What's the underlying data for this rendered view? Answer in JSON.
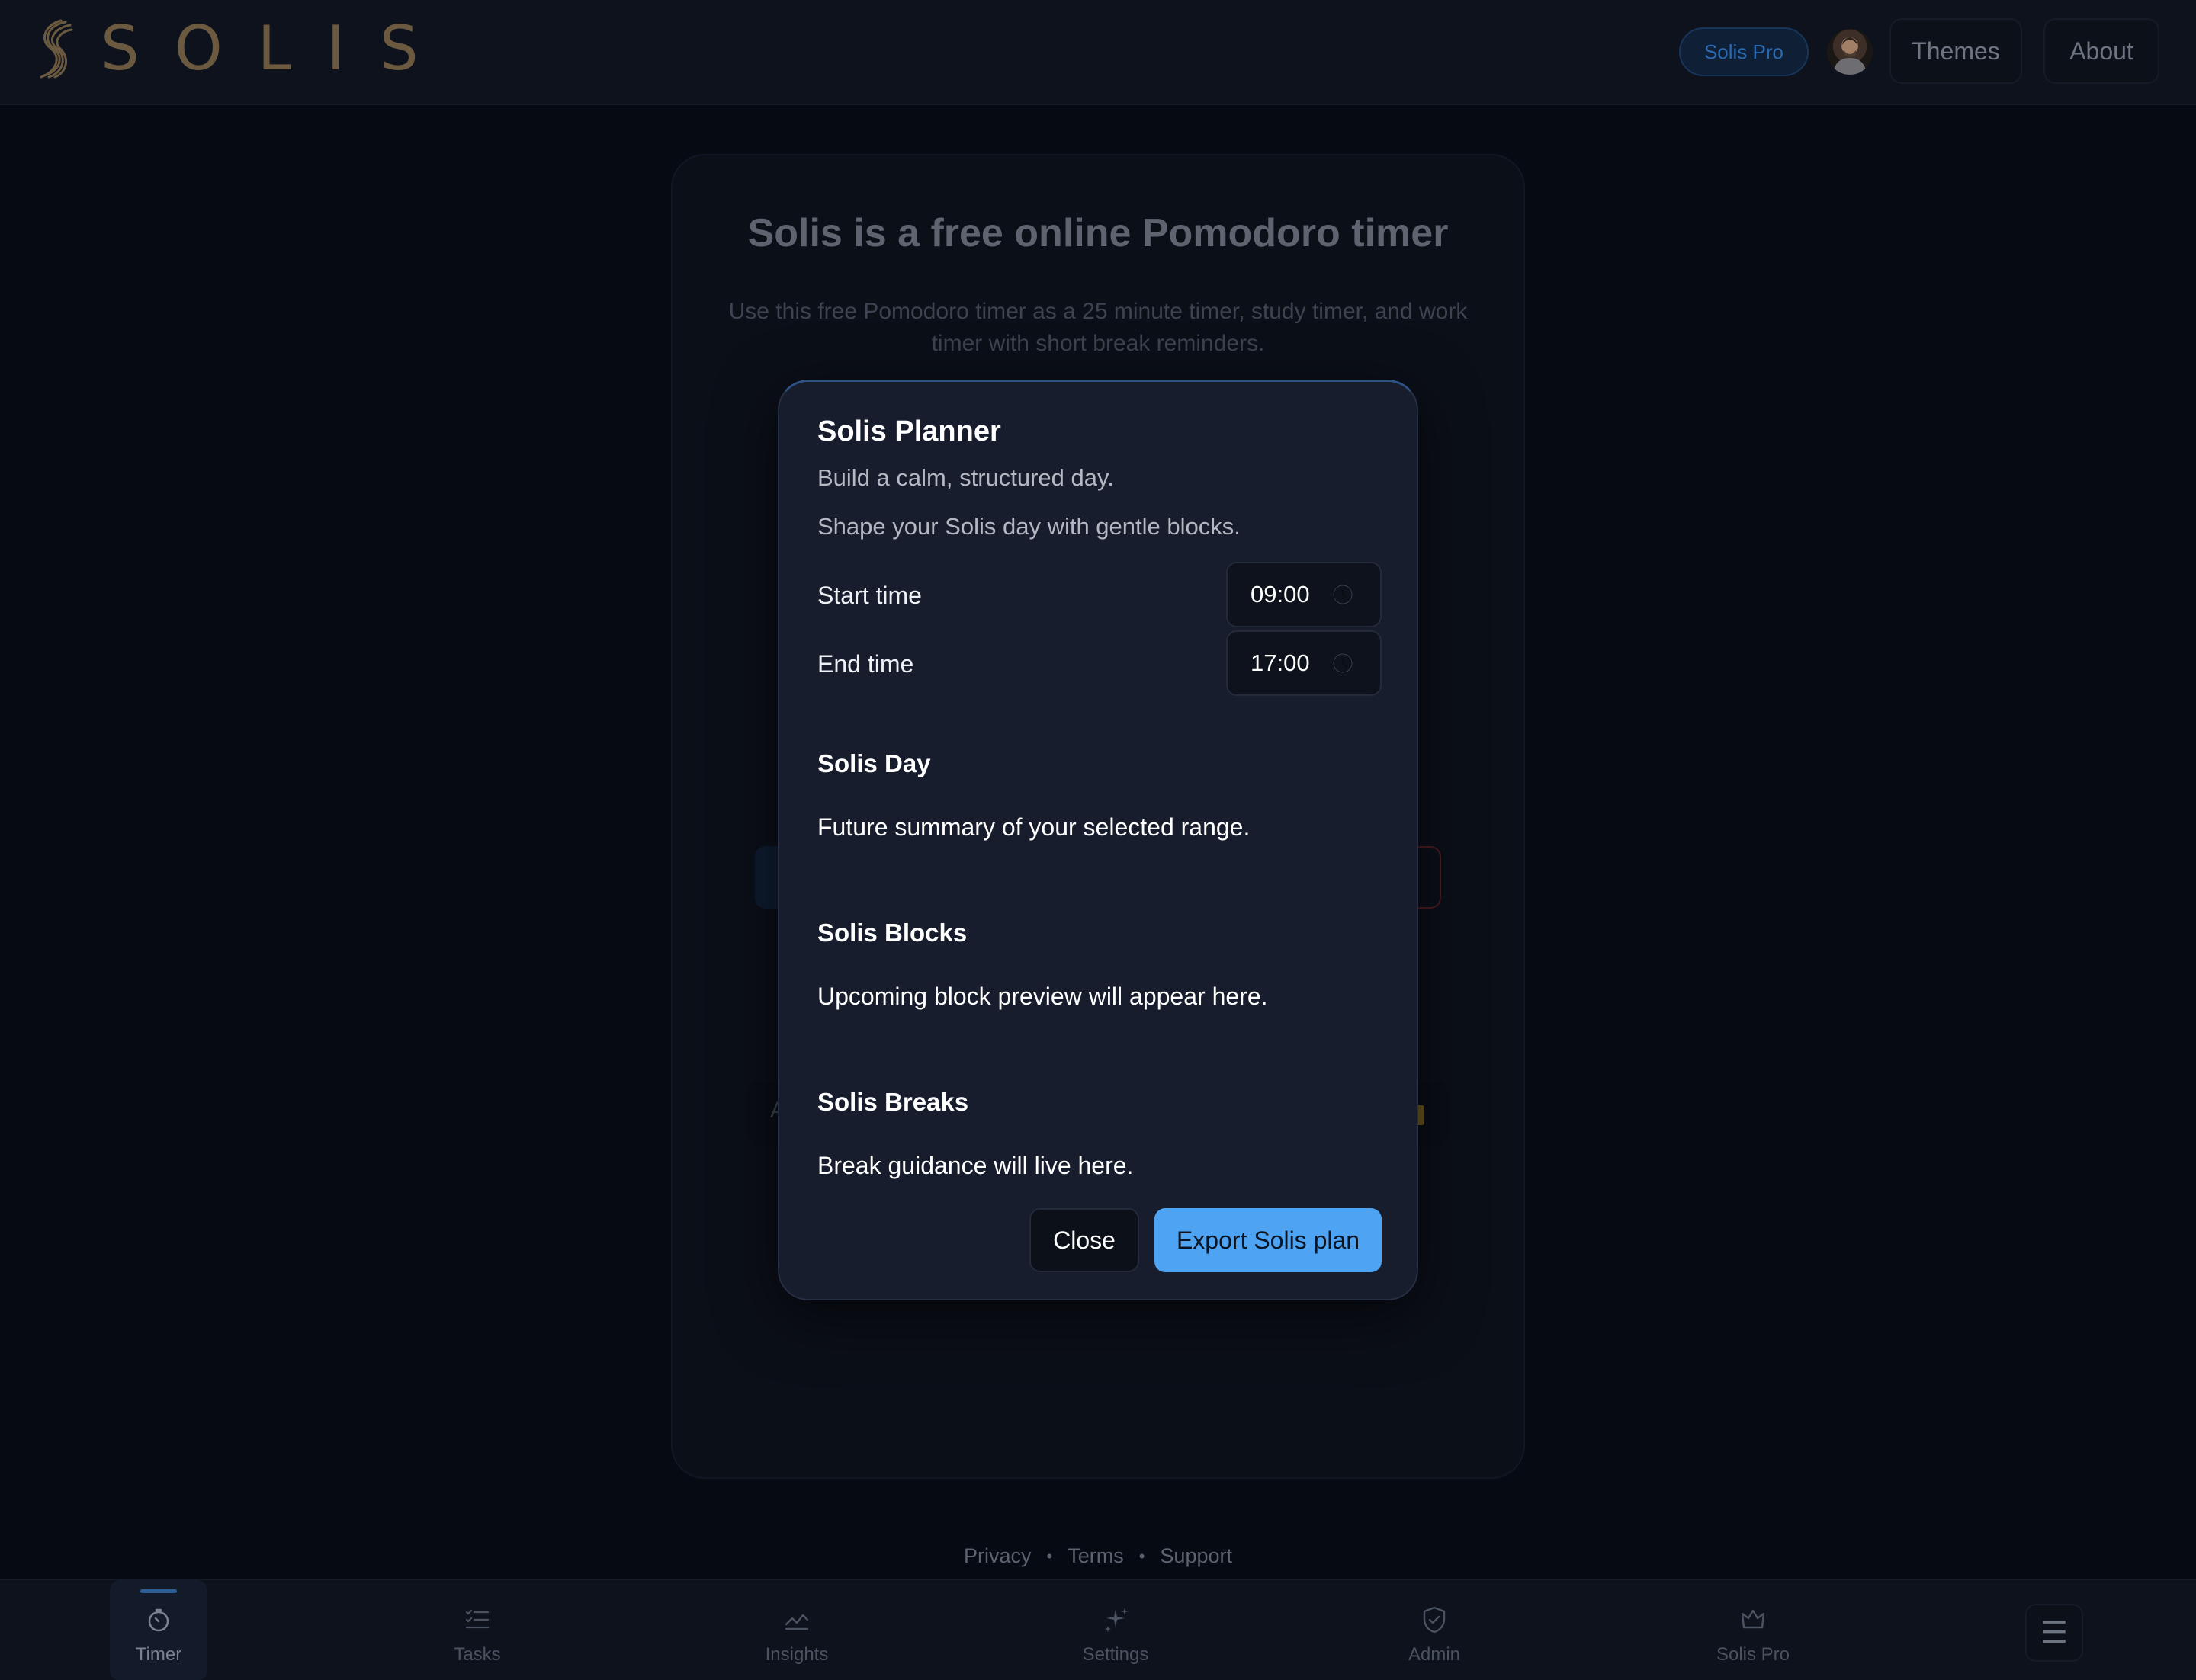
{
  "header": {
    "brand": "SOLIS",
    "pro_badge": "Solis Pro",
    "nav": {
      "themes": "Themes",
      "about": "About"
    }
  },
  "background": {
    "title": "Solis is a free online Pomodoro timer",
    "subtitle": "Use this free Pomodoro timer as a 25 minute timer, study timer, and work timer with short break reminders.",
    "row_letter": "A"
  },
  "modal": {
    "title": "Solis Planner",
    "tagline": "Build a calm, structured day.",
    "description": "Shape your Solis day with gentle blocks.",
    "start_label": "Start time",
    "start_value": "09:00",
    "end_label": "End time",
    "end_value": "17:00",
    "sections": [
      {
        "heading": "Solis Day",
        "body": "Future summary of your selected range."
      },
      {
        "heading": "Solis Blocks",
        "body": "Upcoming block preview will appear here."
      },
      {
        "heading": "Solis Breaks",
        "body": "Break guidance will live here."
      }
    ],
    "close_label": "Close",
    "export_label": "Export Solis plan"
  },
  "footer": {
    "links": [
      "Privacy",
      "Terms",
      "Support"
    ],
    "separator": "•"
  },
  "bottom_nav": {
    "items": [
      {
        "label": "Timer",
        "icon": "timer-icon",
        "active": true
      },
      {
        "label": "Tasks",
        "icon": "tasks-icon"
      },
      {
        "label": "Insights",
        "icon": "insights-icon"
      },
      {
        "label": "Settings",
        "icon": "settings-sparkle-icon"
      },
      {
        "label": "Admin",
        "icon": "shield-check-icon"
      },
      {
        "label": "Solis Pro",
        "icon": "crown-icon"
      }
    ],
    "menu_glyph": "☰"
  },
  "colors": {
    "accent": "#4ea4f2",
    "background": "#060a12",
    "modal": "#171d2c",
    "brand_gold": "#6b5a3f"
  }
}
